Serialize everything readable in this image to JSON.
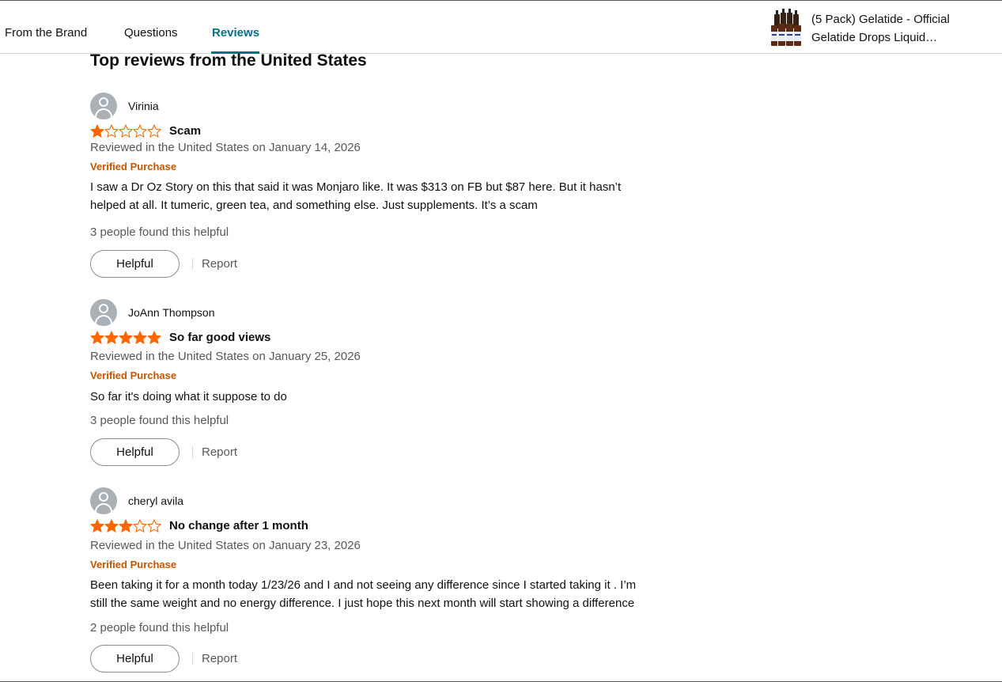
{
  "nav": {
    "tabs": [
      {
        "label": "From the Brand"
      },
      {
        "label": "Questions"
      },
      {
        "label": "Reviews"
      }
    ],
    "active_tab": "Reviews",
    "product": {
      "title_line1": "(5 Pack) Gelatide - Official",
      "title_line2": "Gelatide Drops Liquid…"
    }
  },
  "heading": "Top reviews from the United States",
  "colors": {
    "accent": "#007185",
    "star": "#ff6600",
    "verified": "#c45500",
    "muted": "#565959"
  },
  "reviews": [
    {
      "name": "Virinia",
      "rating": 1,
      "title": "Scam",
      "date": "Reviewed in the United States on January 14, 2026",
      "verified": "Verified Purchase",
      "body": [
        "I saw a Dr Oz Story on this that said it was Monjaro like. It was $313 on FB but $87 here. But it hasn’t",
        "helped at all. It tumeric, green tea, and something else. Just supplements. It’s a scam"
      ],
      "helpful_count": "3 people found this helpful",
      "helpful_label": "Helpful",
      "report_label": "Report"
    },
    {
      "name": "JoAnn Thompson",
      "rating": 5,
      "title": "So far good views",
      "date": "Reviewed in the United States on January 25, 2026",
      "verified": "Verified Purchase",
      "body": [
        "So far it's doing what it suppose to do"
      ],
      "helpful_count": "3 people found this helpful",
      "helpful_label": "Helpful",
      "report_label": "Report"
    },
    {
      "name": "cheryl avila",
      "rating": 3,
      "title": "No change after 1 month",
      "date": "Reviewed in the United States on January 23, 2026",
      "verified": "Verified Purchase",
      "body": [
        "Been taking it for a month today 1/23/26 and I and not seeing any difference since I started taking it . I’m",
        "still the same weight and no energy difference. I just hope this next month will start showing a difference"
      ],
      "helpful_count": "2 people found this helpful",
      "helpful_label": "Helpful",
      "report_label": "Report"
    }
  ]
}
